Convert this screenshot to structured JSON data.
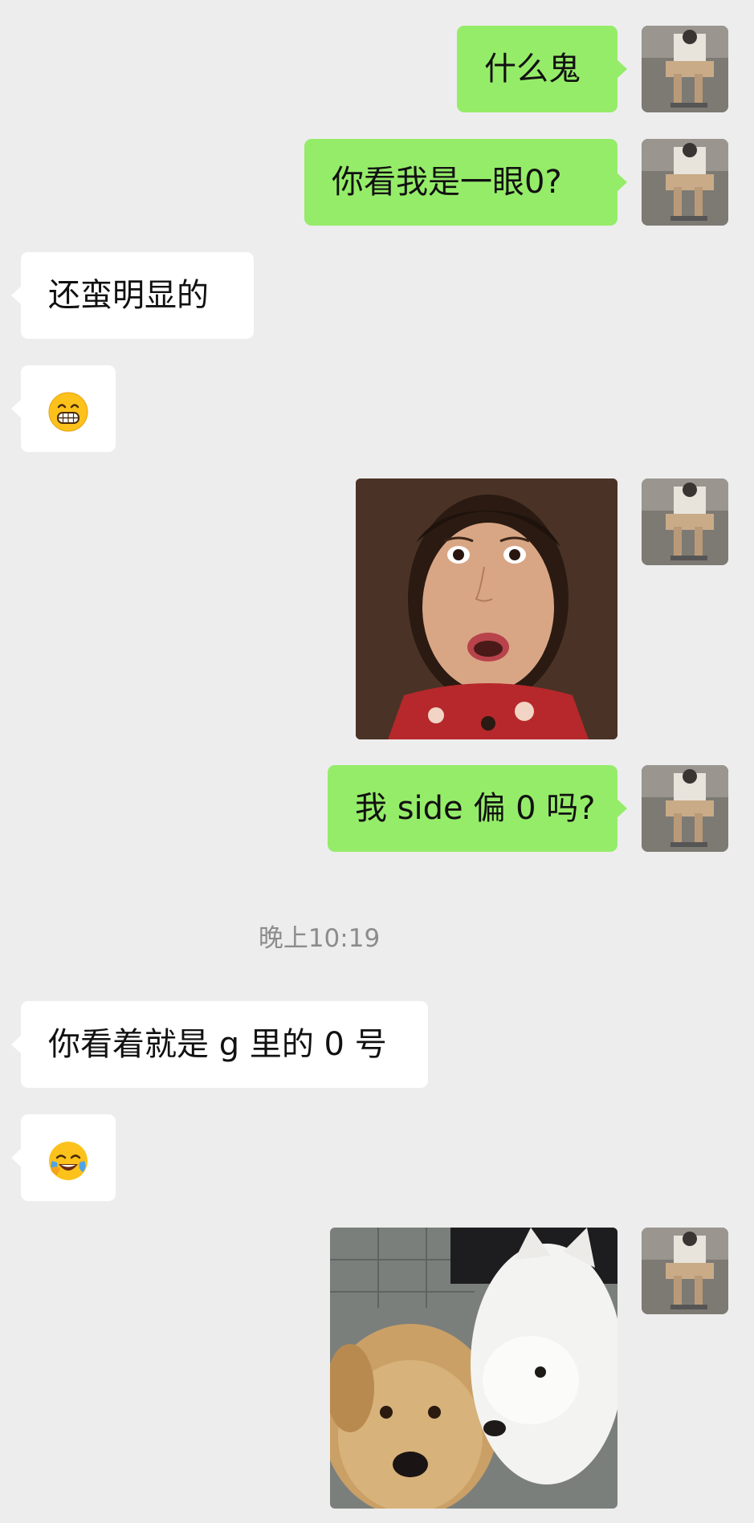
{
  "messages": [
    {
      "id": "m1",
      "side": "out",
      "type": "text",
      "text": "什么鬼"
    },
    {
      "id": "m2",
      "side": "out",
      "type": "text",
      "text": "你看我是一眼0?"
    },
    {
      "id": "m3",
      "side": "in",
      "type": "text",
      "text": "还蛮明显的"
    },
    {
      "id": "m4",
      "side": "in",
      "type": "emoji",
      "emoji": "grinning-face-with-teeth"
    },
    {
      "id": "m5",
      "side": "out",
      "type": "image",
      "image": "shocked-woman-sticker"
    },
    {
      "id": "m6",
      "side": "out",
      "type": "text",
      "text": "我 side 偏 0 吗?"
    },
    {
      "id": "m7",
      "side": "in",
      "type": "text",
      "text": "你看着就是 g 里的 0 号"
    },
    {
      "id": "m8",
      "side": "in",
      "type": "emoji",
      "emoji": "face-with-tears-of-joy"
    },
    {
      "id": "m9",
      "side": "out",
      "type": "image",
      "image": "two-dogs-sticker"
    }
  ],
  "timestamp": "晚上10:19",
  "colors": {
    "background": "#ededed",
    "outgoing_bubble": "#95ec69",
    "incoming_bubble": "#ffffff",
    "timestamp_text": "#8c8c8c"
  }
}
